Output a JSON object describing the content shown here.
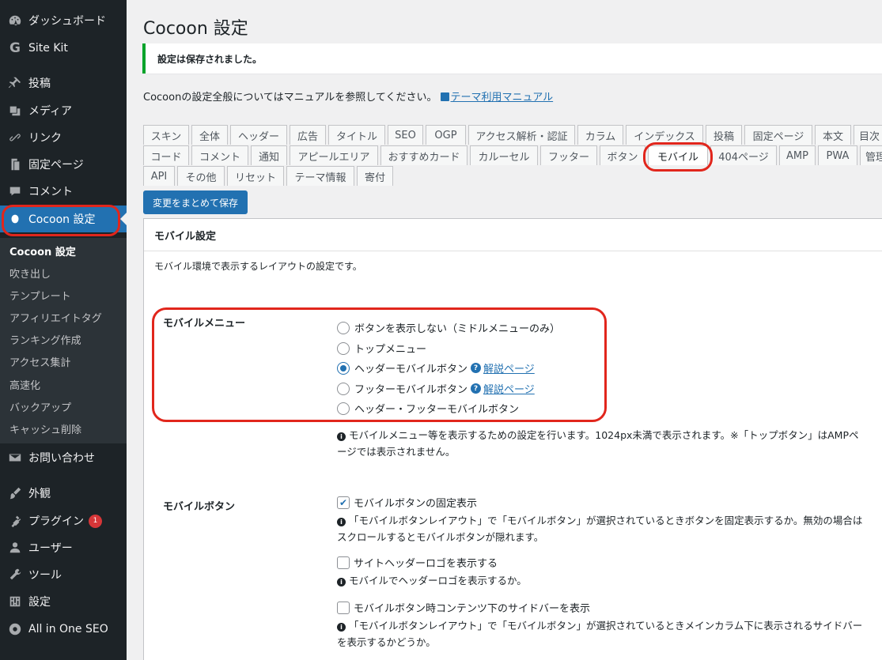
{
  "sidebar": {
    "items": [
      {
        "label": "ダッシュボード",
        "icon": "dashboard-icon"
      },
      {
        "label": "Site Kit",
        "icon": "site-kit-icon"
      },
      {
        "label": "投稿",
        "icon": "pin-icon"
      },
      {
        "label": "メディア",
        "icon": "media-icon"
      },
      {
        "label": "リンク",
        "icon": "link-icon"
      },
      {
        "label": "固定ページ",
        "icon": "page-icon"
      },
      {
        "label": "コメント",
        "icon": "comment-icon"
      },
      {
        "label": "Cocoon 設定",
        "icon": "cocoon-icon"
      },
      {
        "label": "お問い合わせ",
        "icon": "mail-icon"
      },
      {
        "label": "外観",
        "icon": "brush-icon"
      },
      {
        "label": "プラグイン",
        "icon": "plugin-icon",
        "badge": "1"
      },
      {
        "label": "ユーザー",
        "icon": "user-icon"
      },
      {
        "label": "ツール",
        "icon": "wrench-icon"
      },
      {
        "label": "設定",
        "icon": "settings-icon"
      },
      {
        "label": "All in One SEO",
        "icon": "seo-icon"
      }
    ],
    "submenu": [
      "Cocoon 設定",
      "吹き出し",
      "テンプレート",
      "アフィリエイトタグ",
      "ランキング作成",
      "アクセス集計",
      "高速化",
      "バックアップ",
      "キャッシュ削除"
    ]
  },
  "page": {
    "title": "Cocoon 設定",
    "notice": "設定は保存されました。",
    "intro": "Cocoonの設定全般についてはマニュアルを参照してください。",
    "manual_link": "テーマ利用マニュアル"
  },
  "tabs": {
    "row1": [
      "スキン",
      "全体",
      "ヘッダー",
      "広告",
      "タイトル",
      "SEO",
      "OGP",
      "アクセス解析・認証",
      "カラム",
      "インデックス",
      "投稿",
      "固定ページ",
      "本文",
      "目次"
    ],
    "row2": [
      "コード",
      "コメント",
      "通知",
      "アピールエリア",
      "おすすめカード",
      "カルーセル",
      "フッター",
      "ボタン",
      "モバイル",
      "404ページ",
      "AMP",
      "PWA",
      "管理"
    ],
    "row3": [
      "API",
      "その他",
      "リセット",
      "テーマ情報",
      "寄付"
    ],
    "active": "モバイル"
  },
  "save_button": "変更をまとめて保存",
  "panel": {
    "title": "モバイル設定",
    "description": "モバイル環境で表示するレイアウトの設定です。",
    "mobile_menu": {
      "label": "モバイルメニュー",
      "options": [
        {
          "label": "ボタンを表示しない（ミドルメニューのみ）",
          "checked": false
        },
        {
          "label": "トップメニュー",
          "checked": false
        },
        {
          "label": "ヘッダーモバイルボタン",
          "checked": true,
          "help_link": "解説ページ"
        },
        {
          "label": "フッターモバイルボタン",
          "checked": false,
          "help_link": "解説ページ"
        },
        {
          "label": "ヘッダー・フッターモバイルボタン",
          "checked": false
        }
      ],
      "note": "モバイルメニュー等を表示するための設定を行います。1024px未満で表示されます。※「トップボタン」はAMPページでは表示されません。"
    },
    "mobile_button": {
      "label": "モバイルボタン",
      "checkboxes": [
        {
          "label": "モバイルボタンの固定表示",
          "checked": true,
          "note": "「モバイルボタンレイアウト」で「モバイルボタン」が選択されているときボタンを固定表示するか。無効の場合はスクロールするとモバイルボタンが隠れます。"
        },
        {
          "label": "サイトヘッダーロゴを表示する",
          "checked": false,
          "note": "モバイルでヘッダーロゴを表示するか。"
        },
        {
          "label": "モバイルボタン時コンテンツ下のサイドバーを表示",
          "checked": false,
          "note": "「モバイルボタンレイアウト」で「モバイルボタン」が選択されているときメインカラム下に表示されるサイドバーを表示するかどうか。"
        }
      ]
    }
  },
  "colors": {
    "sidebar_bg": "#1d2327",
    "accent": "#2271b1",
    "highlight": "#e1261c",
    "success": "#00a32a"
  }
}
